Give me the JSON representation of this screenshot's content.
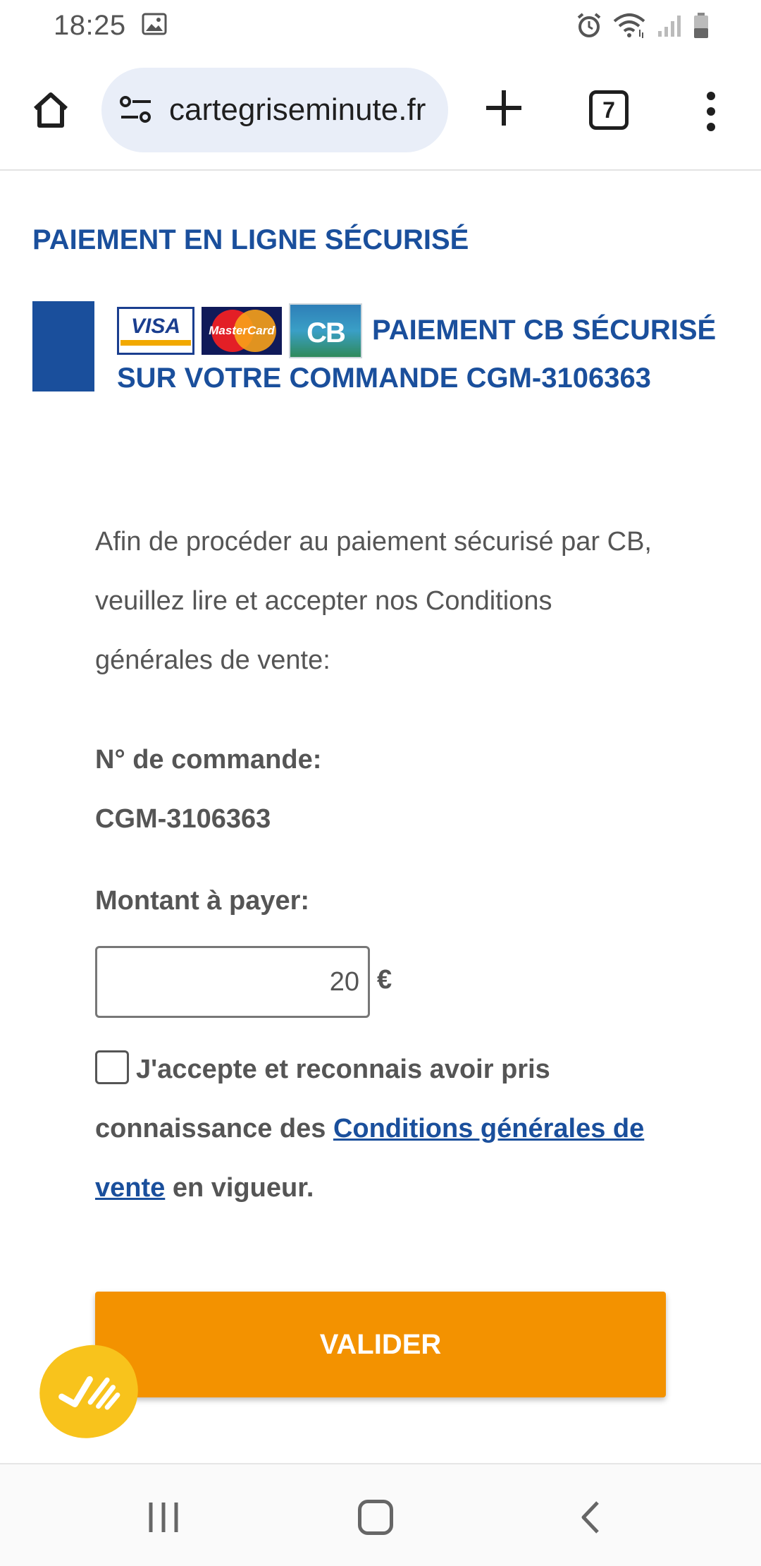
{
  "status_bar": {
    "time": "18:25"
  },
  "browser": {
    "url": "cartegriseminute.fr",
    "tab_count": "7"
  },
  "page": {
    "section_title": "PAIEMENT EN LIGNE SÉCURISÉ",
    "cards": [
      "VISA",
      "MasterCard",
      "CB"
    ],
    "secure_heading": "PAIEMENT CB SÉCURISÉ SUR VOTRE COMMANDE CGM-3106363",
    "intro": "Afin de procéder au paiement sécurisé par CB, veuillez lire et accepter nos Conditions générales de vente:",
    "order_label": "N° de commande:",
    "order_number": "CGM-3106363",
    "amount_label": "Montant à payer:",
    "amount_value": "20",
    "currency": "€",
    "accept_before": "J'accepte et reconnais avoir pris connaissance des ",
    "accept_link": "Conditions générales de vente",
    "accept_after": " en vigueur.",
    "validate_label": "VALIDER"
  },
  "colors": {
    "brand_blue": "#1a4f9c",
    "button_orange": "#f39200",
    "fab_yellow": "#f8c31c"
  }
}
